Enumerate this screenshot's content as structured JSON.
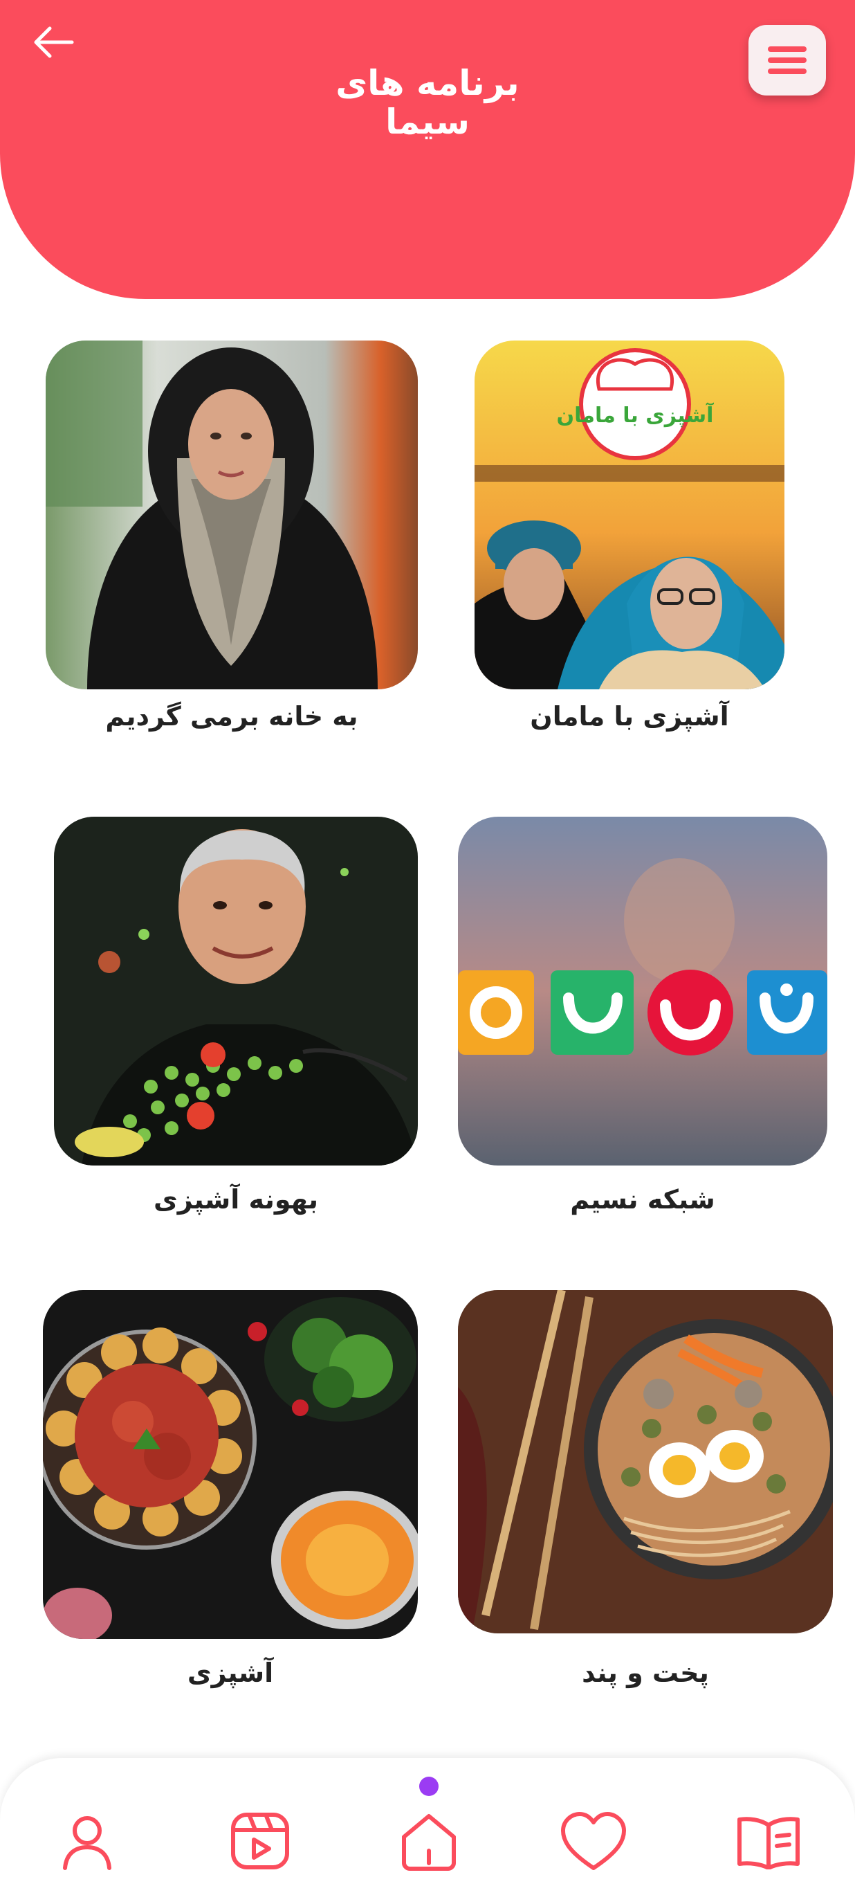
{
  "header": {
    "title_line1": "برنامه های",
    "title_line2": "سیما",
    "back_icon": "arrow-left-icon",
    "menu_icon": "hamburger-menu-icon"
  },
  "programs": [
    {
      "title": "به خانه برمی گردیم"
    },
    {
      "title": "آشپزی با مامان"
    },
    {
      "title": "بهونه آشپزی"
    },
    {
      "title": "شبکه نسیم"
    },
    {
      "title": "آشپزی"
    },
    {
      "title": "پخت و پند"
    }
  ],
  "logo_text": "آشپزی با مامان",
  "bottom_nav": {
    "items": [
      {
        "icon": "profile-icon"
      },
      {
        "icon": "video-play-icon"
      },
      {
        "icon": "home-icon",
        "active": true
      },
      {
        "icon": "heart-icon"
      },
      {
        "icon": "book-icon"
      }
    ]
  },
  "colors": {
    "primary": "#fb4c5c",
    "active_dot": "#9b3cf3",
    "text": "#222222"
  }
}
